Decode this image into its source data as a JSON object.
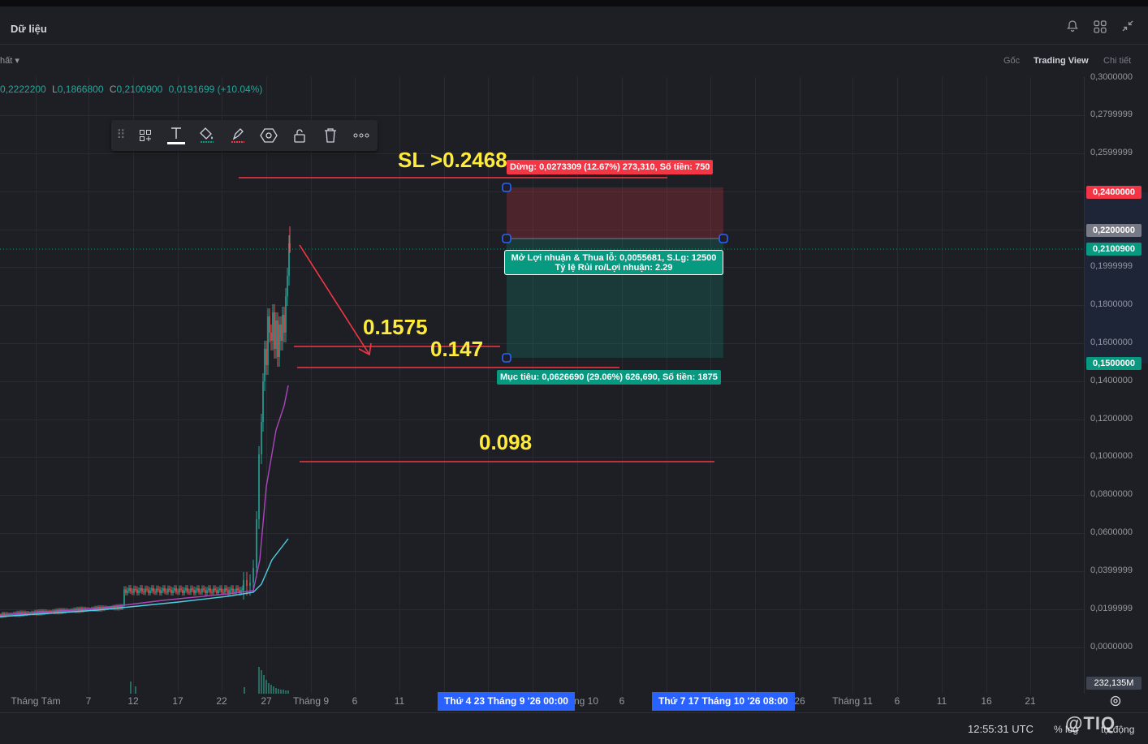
{
  "header": {
    "title": "Dữ liệu",
    "icons": [
      "bell-icon",
      "layout-grid-icon",
      "collapse-icon"
    ]
  },
  "subbar": {
    "left_label": "hất",
    "views": [
      "Gốc",
      "Trading View",
      "Chi tiết"
    ],
    "active_view": "Trading View"
  },
  "ohlc": {
    "h_value": "0,2222200",
    "l_label": "L",
    "l_value": "0,1866800",
    "c_label": "C",
    "c_value": "0,2100900",
    "change": "0,0191699 (+10.04%)"
  },
  "drawing_toolbar": {
    "tools": [
      "drag-handle-icon",
      "template-icon",
      "text-icon",
      "fill-color-icon",
      "line-color-icon",
      "settings-icon",
      "lock-icon",
      "trash-icon",
      "more-icon"
    ]
  },
  "price_scale": {
    "labels": [
      "0,3000000",
      "0,2799999",
      "0,2599999",
      "0,2400000",
      "0,2200000",
      "0,2100900",
      "0,1999999",
      "0,1800000",
      "0,1600000",
      "0,1500000",
      "0,1400000",
      "0,1200000",
      "0,1000000",
      "0,0800000",
      "0,0600000",
      "0,0399999",
      "0,0199999",
      "0,0000000"
    ],
    "box_stop": "0,2400000",
    "box_entry": "0,2200000",
    "box_current": "0,2100900",
    "box_target": "0,1500000",
    "box_volume": "232,135M",
    "colors": {
      "stop": "#f23645",
      "entry": "#787b86",
      "current": "#089981",
      "target": "#089981",
      "volume": "#3d4450"
    }
  },
  "time_axis": {
    "labels": [
      "Tháng Tám",
      "7",
      "12",
      "17",
      "22",
      "27",
      "Tháng 9",
      "6",
      "11",
      "ng 10",
      "6",
      "26",
      "Tháng 11",
      "6",
      "11",
      "16",
      "21"
    ],
    "cursor_start": "Thứ 4 23 Tháng 9 '26   00:00",
    "cursor_end": "Thứ 7 17 Tháng 10 '26   08:00"
  },
  "annotations": {
    "sl": "SL >0.2468",
    "level1": "0.1575",
    "level2": "0.147",
    "level3": "0.098"
  },
  "position_tool": {
    "stop_label": "Dừng: 0,0273309 (12.67%) 273,310, Số tiền: 750",
    "pnl_line1": "Mở Lợi nhuận & Thua lỗ: 0,0055681, S.Lg: 12500",
    "pnl_line2": "Tỷ lệ Rủi ro/Lợi nhuận: 2.29",
    "target_label": "Mục tiêu: 0,0626690 (29.06%) 626,690, Số tiền: 1875"
  },
  "bottom": {
    "clock": "12:55:31 UTC",
    "pct": "%",
    "log": "log",
    "auto": "tự động",
    "watermark": "@TIQ"
  }
}
